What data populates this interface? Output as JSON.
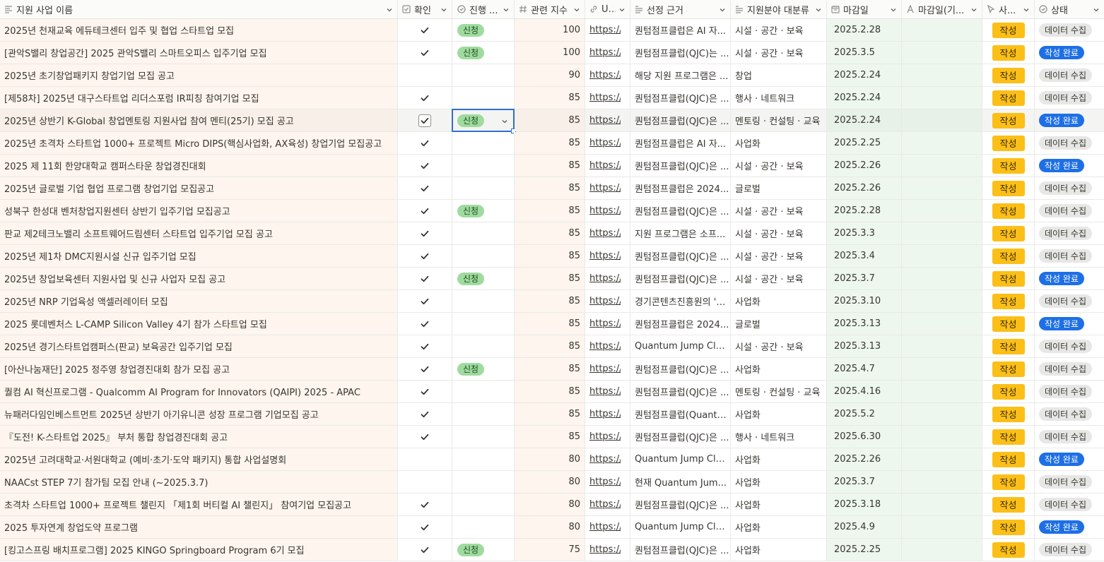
{
  "colors": {
    "check_mark": "#37352f",
    "progress_tag": "#9fdb9f",
    "action_button": "#fbbf17",
    "status_done": "#1e6fe6",
    "status_collect": "#e7e7e5",
    "focus": "#2f6fd6"
  },
  "headers": [
    {
      "key": "name",
      "label": "지원 사업 이름",
      "icon": "text-icon"
    },
    {
      "key": "check",
      "label": "확인",
      "icon": "checkbox-icon"
    },
    {
      "key": "progress",
      "label": "진행 ...",
      "icon": "status-circle-icon"
    },
    {
      "key": "score",
      "label": "관련 지수",
      "icon": "number-icon"
    },
    {
      "key": "url",
      "label": "U...",
      "icon": "link-icon"
    },
    {
      "key": "basis",
      "label": "선정 근거",
      "icon": "text-lines-icon"
    },
    {
      "key": "category",
      "label": "지원분야 대분류",
      "icon": "text-lines-icon"
    },
    {
      "key": "due",
      "label": "마감일",
      "icon": "calendar-icon"
    },
    {
      "key": "due2",
      "label": "마감일(기...",
      "icon": "formula-icon"
    },
    {
      "key": "action",
      "label": "사...",
      "icon": "cursor-icon"
    },
    {
      "key": "status",
      "label": "상태",
      "icon": "status-circle-icon"
    }
  ],
  "rows": [
    {
      "name": "2025년 천재교육 에듀테크센터 입주 및 협업 스타트업 모집",
      "checked": true,
      "progress": "신청",
      "score": "100",
      "url": "https://...",
      "basis": "퀀텀점프클럽은 AI 자...",
      "category": "시설 · 공간 · 보육",
      "due": "2025.2.28",
      "action": "작성",
      "status": "데이터 수집",
      "status_type": "collect"
    },
    {
      "name": "[관악S밸리 창업공간] 2025 관악S밸리 스마트오피스 입주기업 모집",
      "checked": true,
      "progress": "신청",
      "score": "100",
      "url": "https://...",
      "basis": "퀀텀점프클럽(QJC)는 ...",
      "category": "시설 · 공간 · 보육",
      "due": "2025.3.5",
      "action": "작성",
      "status": "작성 완료",
      "status_type": "done"
    },
    {
      "name": "2025년 초기창업패키지 창업기업 모집 공고",
      "checked": false,
      "progress": "",
      "score": "90",
      "url": "https://...",
      "basis": "해당 지원 프로그램은 ...",
      "category": "창업",
      "due": "2025.2.24",
      "action": "작성",
      "status": "데이터 수집",
      "status_type": "collect"
    },
    {
      "name": "[제58차] 2025년 대구스타트업 리더스포럼 IR피칭 참여기업 모집",
      "checked": true,
      "progress": "",
      "score": "85",
      "url": "https://...",
      "basis": "퀀텀점프클럽(QJC)은 ...",
      "category": "행사 · 네트워크",
      "due": "2025.2.24",
      "action": "작성",
      "status": "데이터 수집",
      "status_type": "collect"
    },
    {
      "name": "2025년 상반기 K-Global 창업멘토링 지원사업 참여 멘티(25기) 모집 공고",
      "checked": true,
      "progress": "신청",
      "score": "85",
      "url": "https://...",
      "basis": "퀀텀점프클럽(QJC)은 ...",
      "category": "멘토링 · 컨설팅 · 교육",
      "due": "2025.2.24",
      "action": "작성",
      "status": "작성 완료",
      "status_type": "done",
      "selected": true
    },
    {
      "name": "2025년 초격차 스타트업 1000+ 프로젝트 Micro DIPS(핵심사업화, AX육성) 창업기업 모집공고",
      "checked": true,
      "progress": "",
      "score": "85",
      "url": "https://...",
      "basis": "퀀텀점프클럽은 AI 자...",
      "category": "사업화",
      "due": "2025.2.25",
      "action": "작성",
      "status": "데이터 수집",
      "status_type": "collect"
    },
    {
      "name": "2025 제 11회 한양대학교 캠퍼스타운 창업경진대회",
      "checked": true,
      "progress": "",
      "score": "85",
      "url": "https://...",
      "basis": "퀀텀점프클럽(QJC)은 ...",
      "category": "시설 · 공간 · 보육",
      "due": "2025.2.26",
      "action": "작성",
      "status": "작성 완료",
      "status_type": "done"
    },
    {
      "name": "2025년 글로벌 기업 협업 프로그램 창업기업 모집공고",
      "checked": true,
      "progress": "",
      "score": "85",
      "url": "https://...",
      "basis": "퀀텀점프클럽은 2024...",
      "category": "글로벌",
      "due": "2025.2.26",
      "action": "작성",
      "status": "데이터 수집",
      "status_type": "collect"
    },
    {
      "name": "성북구 한성대 벤처창업지원센터 상반기 입주기업 모집공고",
      "checked": true,
      "progress": "신청",
      "score": "85",
      "url": "https://...",
      "basis": "퀀텀점프클럽(QJC)은 ...",
      "category": "시설 · 공간 · 보육",
      "due": "2025.2.28",
      "action": "작성",
      "status": "데이터 수집",
      "status_type": "collect"
    },
    {
      "name": "판교 제2테크노밸리 소프트웨어드림센터 스타트업 입주기업 모집 공고",
      "checked": true,
      "progress": "",
      "score": "85",
      "url": "https://...",
      "basis": "지원 프로그램은 소프...",
      "category": "시설 · 공간 · 보육",
      "due": "2025.3.3",
      "action": "작성",
      "status": "데이터 수집",
      "status_type": "collect"
    },
    {
      "name": "2025년 제1차 DMC지원시설 신규 입주기업 모집",
      "checked": true,
      "progress": "",
      "score": "85",
      "url": "https://...",
      "basis": "퀀텀점프클럽(QJC)은 ...",
      "category": "시설 · 공간 · 보육",
      "due": "2025.3.4",
      "action": "작성",
      "status": "데이터 수집",
      "status_type": "collect"
    },
    {
      "name": "2025년 창업보육센터 지원사업 및 신규 사업자 모집 공고",
      "checked": true,
      "progress": "신청",
      "score": "85",
      "url": "https://...",
      "basis": "퀀텀점프클럽(QJC)은 ...",
      "category": "시설 · 공간 · 보육",
      "due": "2025.3.7",
      "action": "작성",
      "status": "작성 완료",
      "status_type": "done"
    },
    {
      "name": "2025년 NRP 기업육성 액셀러레이터 모집",
      "checked": true,
      "progress": "",
      "score": "85",
      "url": "https://...",
      "basis": "경기콘텐츠진흥원의 '2...",
      "category": "사업화",
      "due": "2025.3.10",
      "action": "작성",
      "status": "데이터 수집",
      "status_type": "collect"
    },
    {
      "name": "2025 롯데벤처스 L-CAMP Silicon Valley 4기 참가 스타트업 모집",
      "checked": true,
      "progress": "",
      "score": "85",
      "url": "https://...",
      "basis": "퀀텀점프클럽은 2024...",
      "category": "글로벌",
      "due": "2025.3.13",
      "action": "작성",
      "status": "작성 완료",
      "status_type": "done"
    },
    {
      "name": "2025년 경기스타트업캠퍼스(판교) 보육공간 입주기업 모집",
      "checked": true,
      "progress": "",
      "score": "85",
      "url": "https://...",
      "basis": "Quantum Jump Clu...",
      "category": "시설 · 공간 · 보육",
      "due": "2025.3.13",
      "action": "작성",
      "status": "데이터 수집",
      "status_type": "collect"
    },
    {
      "name": "[아산나눔재단] 2025 정주영 창업경진대회 참가 모집 공고",
      "checked": true,
      "progress": "신청",
      "score": "85",
      "url": "https://...",
      "basis": "퀀텀점프클럽(QJC)은 ...",
      "category": "사업화",
      "due": "2025.4.7",
      "action": "작성",
      "status": "데이터 수집",
      "status_type": "collect"
    },
    {
      "name": "퀄컴 AI 혁신프로그램 - Qualcomm AI Program for Innovators (QAIPI) 2025 - APAC",
      "checked": true,
      "progress": "",
      "score": "85",
      "url": "https://...",
      "basis": "퀀텀점프클럽(QJC)은 ...",
      "category": "멘토링 · 컨설팅 · 교육",
      "due": "2025.4.16",
      "action": "작성",
      "status": "데이터 수집",
      "status_type": "collect"
    },
    {
      "name": "뉴패러다임인베스트먼트 2025년 상반기 아기유니콘 성장 프로그램 기업모집 공고",
      "checked": true,
      "progress": "",
      "score": "85",
      "url": "https://...",
      "basis": "퀀텀점프클럽(Quantu...",
      "category": "사업화",
      "due": "2025.5.2",
      "action": "작성",
      "status": "데이터 수집",
      "status_type": "collect"
    },
    {
      "name": "『도전! K-스타트업 2025』 부처 통합 창업경진대회 공고",
      "checked": true,
      "progress": "",
      "score": "85",
      "url": "https://...",
      "basis": "퀀텀점프클럽(QJC)은 ...",
      "category": "행사 · 네트워크",
      "due": "2025.6.30",
      "action": "작성",
      "status": "데이터 수집",
      "status_type": "collect"
    },
    {
      "name": "2025년 고려대학교·서원대학교 (예비·초기·도약 패키지) 통합 사업설명회",
      "checked": false,
      "progress": "",
      "score": "80",
      "url": "https://...",
      "basis": "Quantum Jump Clu...",
      "category": "사업화",
      "due": "2025.2.26",
      "action": "작성",
      "status": "작성 완료",
      "status_type": "done"
    },
    {
      "name": "NAACst STEP 7기 참가팀 모집 안내 (~2025.3.7)",
      "checked": false,
      "progress": "",
      "score": "80",
      "url": "https://...",
      "basis": "현재 Quantum Jum...",
      "category": "사업화",
      "due": "2025.3.7",
      "action": "작성",
      "status": "데이터 수집",
      "status_type": "collect"
    },
    {
      "name": "초격차 스타트업 1000+ 프로젝트 챌린지 「제1회 버티컬 AI 챌린지」 참여기업 모집공고",
      "checked": true,
      "progress": "",
      "score": "80",
      "url": "https://...",
      "basis": "퀀텀점프클럽(QJC)은 ...",
      "category": "사업화",
      "due": "2025.3.18",
      "action": "작성",
      "status": "데이터 수집",
      "status_type": "collect"
    },
    {
      "name": "2025 투자연계 창업도약 프로그램",
      "checked": true,
      "progress": "",
      "score": "80",
      "url": "https://...",
      "basis": "Quantum Jump Clu...",
      "category": "사업화",
      "due": "2025.4.9",
      "action": "작성",
      "status": "작성 완료",
      "status_type": "done"
    },
    {
      "name": "[킹고스프링 배치프로그램] 2025 KINGO Springboard Program 6기 모집",
      "checked": true,
      "progress": "신청",
      "score": "75",
      "url": "https://...",
      "basis": "퀀텀점프클럽(QJC)은 ...",
      "category": "사업화",
      "due": "2025.2.25",
      "action": "작성",
      "status": "데이터 수집",
      "status_type": "collect"
    }
  ]
}
